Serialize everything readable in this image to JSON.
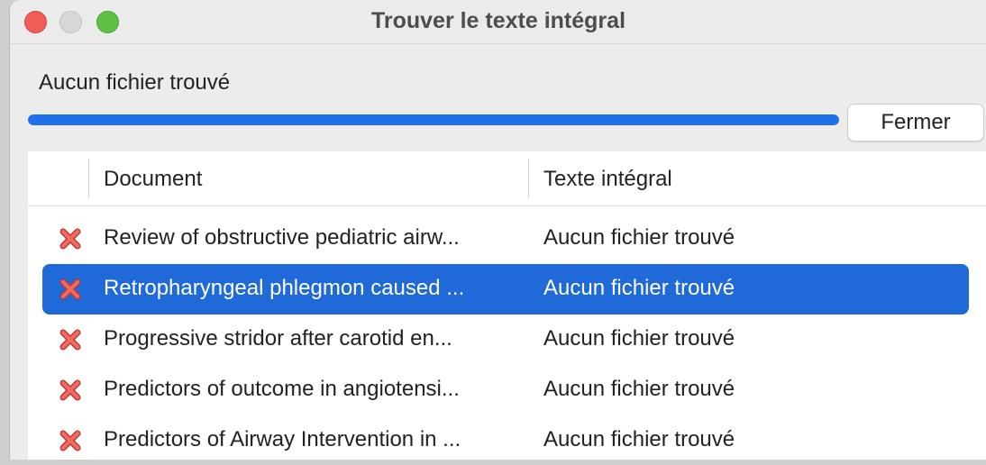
{
  "window": {
    "title": "Trouver le texte intégral"
  },
  "status_text": "Aucun fichier trouvé",
  "progress": 1.0,
  "close_button_label": "Fermer",
  "table": {
    "columns": [
      "Document",
      "Texte intégral"
    ],
    "rows": [
      {
        "status_icon": "red-x-icon",
        "document": "Review of obstructive pediatric airw...",
        "fulltext": "Aucun fichier trouvé",
        "selected": false
      },
      {
        "status_icon": "red-x-icon",
        "document": "Retropharyngeal phlegmon caused ...",
        "fulltext": "Aucun fichier trouvé",
        "selected": true
      },
      {
        "status_icon": "red-x-icon",
        "document": "Progressive stridor after carotid en...",
        "fulltext": "Aucun fichier trouvé",
        "selected": false
      },
      {
        "status_icon": "red-x-icon",
        "document": "Predictors of outcome in angiotensi...",
        "fulltext": "Aucun fichier trouvé",
        "selected": false
      },
      {
        "status_icon": "red-x-icon",
        "document": "Predictors of Airway Intervention in ...",
        "fulltext": "Aucun fichier trouvé",
        "selected": false
      }
    ]
  },
  "colors": {
    "accent": "#1e71e8",
    "selection": "#1f69d9",
    "error_icon": "#e5534b"
  }
}
